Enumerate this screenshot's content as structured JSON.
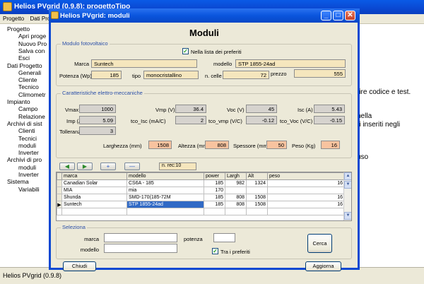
{
  "app": {
    "title": "Helios PVgrid (0.9.8): progettoTipo",
    "menu": [
      "Progetto",
      "Dati Prog"
    ],
    "tree": [
      {
        "label": "Progetto",
        "level": 0
      },
      {
        "label": "Apri proge",
        "level": 1
      },
      {
        "label": "Nuovo Pro",
        "level": 1
      },
      {
        "label": "Salva con",
        "level": 1
      },
      {
        "label": "Esci",
        "level": 1
      },
      {
        "label": "Dati Progetto",
        "level": 0
      },
      {
        "label": "Generali",
        "level": 1
      },
      {
        "label": "Cliente",
        "level": 1
      },
      {
        "label": "Tecnico",
        "level": 1
      },
      {
        "label": "Climometr",
        "level": 1
      },
      {
        "label": "Impianto",
        "level": 0
      },
      {
        "label": "Campo",
        "level": 1
      },
      {
        "label": "Relazione",
        "level": 1
      },
      {
        "label": "Archivi di sist",
        "level": 0
      },
      {
        "label": "Clienti",
        "level": 1
      },
      {
        "label": "Tecnici",
        "level": 1
      },
      {
        "label": "moduli",
        "level": 1
      },
      {
        "label": "Inverter",
        "level": 1
      },
      {
        "label": "Archivi di pro",
        "level": 0
      },
      {
        "label": "moduli",
        "level": 1
      },
      {
        "label": "Inverter",
        "level": 1
      },
      {
        "label": "Sistema",
        "level": 0
      },
      {
        "label": "Variabili",
        "level": 1
      }
    ],
    "right_text": [
      "rire codice e test.",
      "nella",
      "ri inseriti negli",
      "uso"
    ],
    "status": "Helios PVgrid (0.9.8)"
  },
  "dialog": {
    "title": "Helios PVgrid: moduli",
    "heading": "Moduli",
    "section_modulo": "Modulo fotovoltaico",
    "preferiti_label": "Nella lista dei preferiti",
    "preferiti_checked": true,
    "marca_label": "Marca",
    "marca_value": "Suntech",
    "modello_label": "modello",
    "modello_value": "STP 1855-24ad",
    "potenza_label": "Potenza (Wp)",
    "potenza_value": "185",
    "tipo_label": "tipo",
    "tipo_value": "monocristallino",
    "ncelle_label": "n. celle",
    "ncelle_value": "72",
    "prezzo_label": "prezzo",
    "prezzo_value": "555",
    "section_caratteristiche": "Caratteristiche elettro-meccaniche",
    "vmax_label": "Vmax (V)",
    "vmax_value": "1000",
    "vmp_label": "Vmp (V)",
    "vmp_value": "36.4",
    "voc_label": "Voc (V)",
    "voc_value": "45",
    "isc_label": "Isc (A)",
    "isc_value": "5.43",
    "imp_label": "Imp (A)",
    "imp_value": "5.09",
    "tcoisc_label": "tco_Isc (mA/C)",
    "tcoisc_value": "2",
    "tcovmp_label": "tco_vmp (V/C)",
    "tcovmp_value": "-0.12",
    "tcovoc_label": "tco_Voc (V/C)",
    "tcovoc_value": "-0.15",
    "toll_label": "Tolleranza",
    "toll_value": "3",
    "larghezza_label": "Larghezza (mm)",
    "larghezza_value": "1508",
    "altezza_label": "Altezza (mm)",
    "altezza_value": "808",
    "spessore_label": "Spessore (mm)",
    "spessore_value": "50",
    "peso_label": "Peso (Kg)",
    "peso_value": "16",
    "nav_buttons": [
      "◀",
      "▶",
      "+",
      "—"
    ],
    "nrec_label": "n. rec:10",
    "grid": {
      "columns": [
        "marca",
        "modello",
        "power",
        "Largh",
        "Alt",
        "peso"
      ],
      "rows": [
        [
          "Canadian Solar",
          "CS6A - 185",
          "185",
          "982",
          "1324",
          "16"
        ],
        [
          "MIA",
          "mia",
          "170",
          "",
          "",
          ""
        ],
        [
          "Shunda",
          "SMD-170(185-72M",
          "185",
          "808",
          "1508",
          "16"
        ],
        [
          "Suntech",
          "STP 1855-24ad",
          "185",
          "808",
          "1508",
          "16"
        ]
      ],
      "selected_row": 3
    },
    "section_seleziona": "Seleziona",
    "s_marca_label": "marca",
    "s_modello_label": "modello",
    "s_potenza_label": "potenza",
    "s_preferiti_label": "Tra i preferiti",
    "s_preferiti_checked": true,
    "cerca_label": "Cerca",
    "chiudi_label": "Chiudi",
    "aggiorna_label": "Aggiorna"
  },
  "colors": {
    "titlebar": "#0a55dd",
    "field_tan": "#f5e6bd",
    "field_orange": "#f8c39f",
    "field_gray": "#d6d3ce",
    "selection": "#316ac5"
  }
}
